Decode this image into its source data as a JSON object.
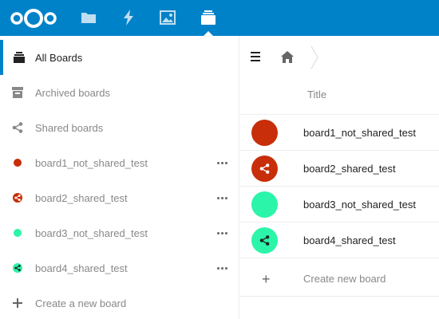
{
  "header": {
    "apps": [
      "files-icon",
      "activity-icon",
      "gallery-icon",
      "deck-icon"
    ],
    "accent": "#0082c9"
  },
  "sidebar": {
    "items": [
      {
        "label": "All Boards",
        "icon": "boards-stack-icon",
        "active": true
      },
      {
        "label": "Archived boards",
        "icon": "archive-icon"
      },
      {
        "label": "Shared boards",
        "icon": "share-icon"
      },
      {
        "label": "board1_not_shared_test",
        "color": "#c72e09",
        "shared": false
      },
      {
        "label": "board2_shared_test",
        "color": "#c72e09",
        "shared": true
      },
      {
        "label": "board3_not_shared_test",
        "color": "#2bf5a8",
        "shared": false
      },
      {
        "label": "board4_shared_test",
        "color": "#2bf5a8",
        "shared": true
      },
      {
        "label": "Create a new board",
        "icon": "plus-icon"
      }
    ]
  },
  "content": {
    "column_title": "Title",
    "boards": [
      {
        "title": "board1_not_shared_test",
        "color": "#c72e09",
        "shared": false
      },
      {
        "title": "board2_shared_test",
        "color": "#c72e09",
        "shared": true
      },
      {
        "title": "board3_not_shared_test",
        "color": "#2bf5a8",
        "shared": false
      },
      {
        "title": "board4_shared_test",
        "color": "#2bf5a8",
        "shared": true
      }
    ],
    "create_label": "Create new board"
  }
}
